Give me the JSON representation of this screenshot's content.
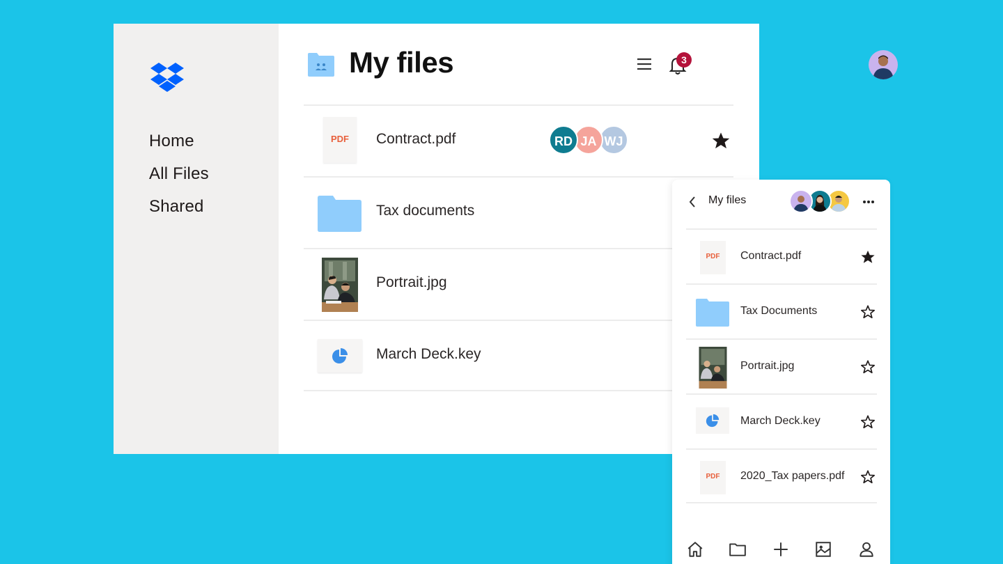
{
  "desktop": {
    "sidebar": {
      "logo": "dropbox-logo",
      "nav": [
        {
          "label": "Home"
        },
        {
          "label": "All Files"
        },
        {
          "label": "Shared"
        }
      ]
    },
    "header": {
      "title": "My files",
      "folder_icon": "shared-folder-icon",
      "menu_icon": "menu-icon",
      "bell_icon": "bell-icon",
      "notification_count": "3",
      "avatar": "user-avatar"
    },
    "files": [
      {
        "name": "Contract.pdf",
        "type": "pdf",
        "thumb_label": "PDF",
        "starred": true,
        "collaborators": [
          {
            "initials": "RD",
            "color": "#0f7c90"
          },
          {
            "initials": "JA",
            "color": "#f5a49b"
          },
          {
            "initials": "WJ",
            "color": "#b4c8e1"
          }
        ]
      },
      {
        "name": "Tax documents",
        "type": "folder"
      },
      {
        "name": "Portrait.jpg",
        "type": "image"
      },
      {
        "name": "March Deck.key",
        "type": "keynote"
      }
    ]
  },
  "mobile": {
    "header": {
      "back_icon": "chevron-left-icon",
      "title": "My files",
      "more_icon": "more-horizontal-icon",
      "avatars": [
        {
          "color": "#c9b3ee"
        },
        {
          "color": "#0f7c90"
        },
        {
          "color": "#f5c842"
        }
      ]
    },
    "files": [
      {
        "name": "Contract.pdf",
        "type": "pdf",
        "thumb_label": "PDF",
        "starred": true
      },
      {
        "name": "Tax Documents",
        "type": "folder",
        "starred": false
      },
      {
        "name": "Portrait.jpg",
        "type": "image",
        "starred": false
      },
      {
        "name": "March Deck.key",
        "type": "keynote",
        "starred": false
      },
      {
        "name": "2020_Tax papers.pdf",
        "type": "pdf",
        "thumb_label": "PDF",
        "starred": false
      }
    ],
    "tabbar": [
      "home-icon",
      "folder-icon",
      "plus-icon",
      "photos-icon",
      "account-icon"
    ]
  },
  "colors": {
    "background": "#1bc4e8",
    "dropbox_blue": "#0061fe",
    "folder_blue": "#90cdfc",
    "pdf_orange": "#e8603c",
    "badge_red": "#b4133b"
  }
}
